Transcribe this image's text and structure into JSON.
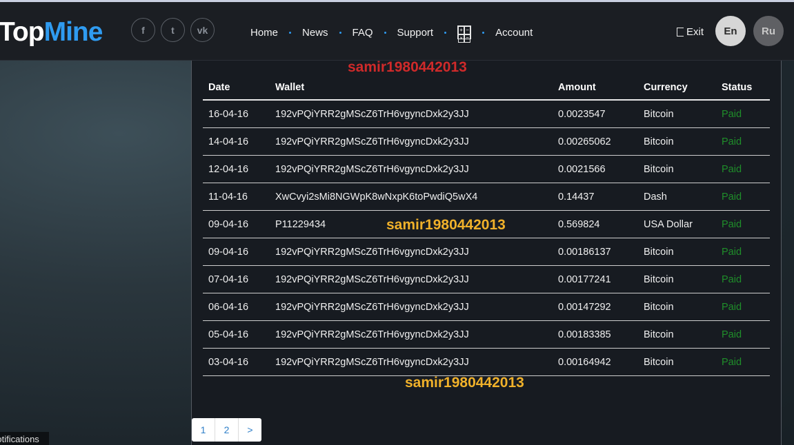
{
  "brand": {
    "part1": "Top",
    "part2": "Mine"
  },
  "socials": [
    {
      "icon": "facebook-icon",
      "glyph": "f"
    },
    {
      "icon": "twitter-icon",
      "glyph": "t"
    },
    {
      "icon": "vk-icon",
      "glyph": "vk"
    }
  ],
  "nav": {
    "home": "Home",
    "news": "News",
    "faq": "FAQ",
    "support": "Support",
    "calculator_icon": "calculator-icon",
    "account": "Account"
  },
  "header_right": {
    "exit": "Exit",
    "lang_en": "En",
    "lang_ru": "Ru"
  },
  "watermarks": {
    "top": "samir1980442013",
    "middle": "samir1980442013",
    "bottom": "samir1980442013"
  },
  "table": {
    "headers": [
      "Date",
      "Wallet",
      "Amount",
      "Currency",
      "Status"
    ],
    "rows": [
      [
        "16-04-16",
        "192vPQiYRR2gMScZ6TrH6vgyncDxk2y3JJ",
        "0.0023547",
        "Bitcoin",
        "Paid"
      ],
      [
        "14-04-16",
        "192vPQiYRR2gMScZ6TrH6vgyncDxk2y3JJ",
        "0.00265062",
        "Bitcoin",
        "Paid"
      ],
      [
        "12-04-16",
        "192vPQiYRR2gMScZ6TrH6vgyncDxk2y3JJ",
        "0.0021566",
        "Bitcoin",
        "Paid"
      ],
      [
        "11-04-16",
        "XwCvyi2sMi8NGWpK8wNxpK6toPwdiQ5wX4",
        "0.14437",
        "Dash",
        "Paid"
      ],
      [
        "09-04-16",
        "P11229434",
        "0.569824",
        "USA Dollar",
        "Paid"
      ],
      [
        "09-04-16",
        "192vPQiYRR2gMScZ6TrH6vgyncDxk2y3JJ",
        "0.00186137",
        "Bitcoin",
        "Paid"
      ],
      [
        "07-04-16",
        "192vPQiYRR2gMScZ6TrH6vgyncDxk2y3JJ",
        "0.00177241",
        "Bitcoin",
        "Paid"
      ],
      [
        "06-04-16",
        "192vPQiYRR2gMScZ6TrH6vgyncDxk2y3JJ",
        "0.00147292",
        "Bitcoin",
        "Paid"
      ],
      [
        "05-04-16",
        "192vPQiYRR2gMScZ6TrH6vgyncDxk2y3JJ",
        "0.00183385",
        "Bitcoin",
        "Paid"
      ],
      [
        "03-04-16",
        "192vPQiYRR2gMScZ6TrH6vgyncDxk2y3JJ",
        "0.00164942",
        "Bitcoin",
        "Paid"
      ]
    ]
  },
  "pagination": [
    "1",
    "2",
    ">"
  ],
  "notifications_label": "Notifications",
  "colors": {
    "accent": "#2f9bf0",
    "paid": "#1f8f2a",
    "watermark_red": "#cf2a2a",
    "watermark_yellow": "#f0b12a"
  }
}
